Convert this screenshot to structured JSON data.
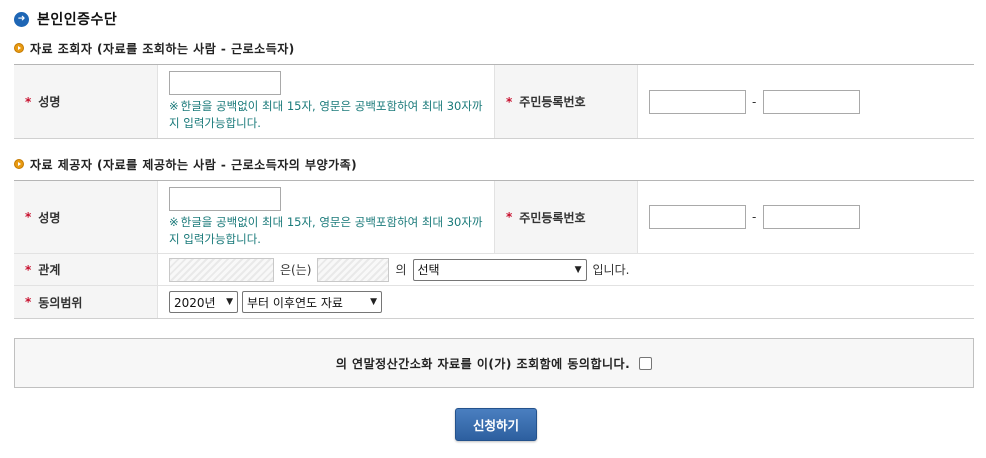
{
  "title": "본인인증수단",
  "viewer_section": {
    "title": "자료 조회자 (자료를 조회하는 사람 - 근로소득자)",
    "name_label": "성명",
    "name_value": "",
    "name_help_mark": "※",
    "name_help": "한글을 공백없이 최대 15자, 영문은 공백포함하여 최대 30자까지 입력가능합니다.",
    "rrn_label": "주민등록번호",
    "rrn_separator": "-",
    "rrn_front": "",
    "rrn_back": ""
  },
  "provider_section": {
    "title": "자료 제공자 (자료를 제공하는 사람 - 근로소득자의 부양가족)",
    "name_label": "성명",
    "name_value": "",
    "name_help_mark": "※",
    "name_help": "한글을 공백없이 최대 15자, 영문은 공백포함하여 최대 30자까지 입력가능합니다.",
    "rrn_label": "주민등록번호",
    "rrn_separator": "-",
    "rrn_front": "",
    "rrn_back": "",
    "relation_label": "관계",
    "relation_text1": "은(는)",
    "relation_text2": "의",
    "relation_select": "선택",
    "relation_suffix": "입니다.",
    "range_label": "동의범위",
    "year_select": "2020년",
    "range_select": "부터 이후연도 자료"
  },
  "consent": {
    "text": "의 연말정산간소화 자료를 이(가) 조회함에 동의합니다.",
    "checked": false
  },
  "required_mark": "*",
  "submit_label": "신청하기"
}
